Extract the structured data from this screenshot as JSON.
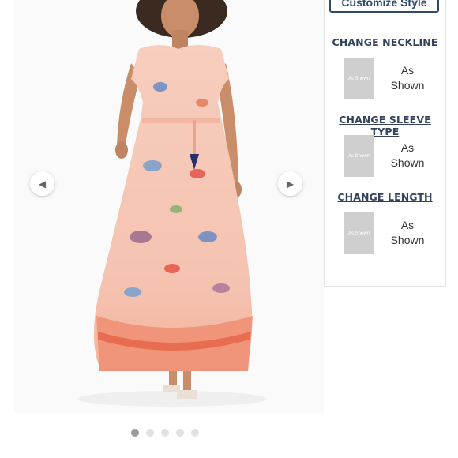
{
  "gallery": {
    "prev_icon": "chevron-left-icon",
    "next_icon": "chevron-right-icon",
    "image_count": 5,
    "active_index": 0
  },
  "panel": {
    "customize_label": "Customize Style",
    "sections": [
      {
        "title": "CHANGE NECKLINE",
        "swatch_text": "As Shown",
        "option_label": "As Shown"
      },
      {
        "title": "CHANGE SLEEVE TYPE",
        "swatch_text": "As Shown",
        "option_label": "As Shown"
      },
      {
        "title": "CHANGE LENGTH",
        "swatch_text": "As Shown",
        "option_label": "As Shown"
      }
    ]
  },
  "colors": {
    "accent": "#2f4a6a",
    "dress_base": "#f6c7b6",
    "dress_border": "#ee8a6a"
  }
}
